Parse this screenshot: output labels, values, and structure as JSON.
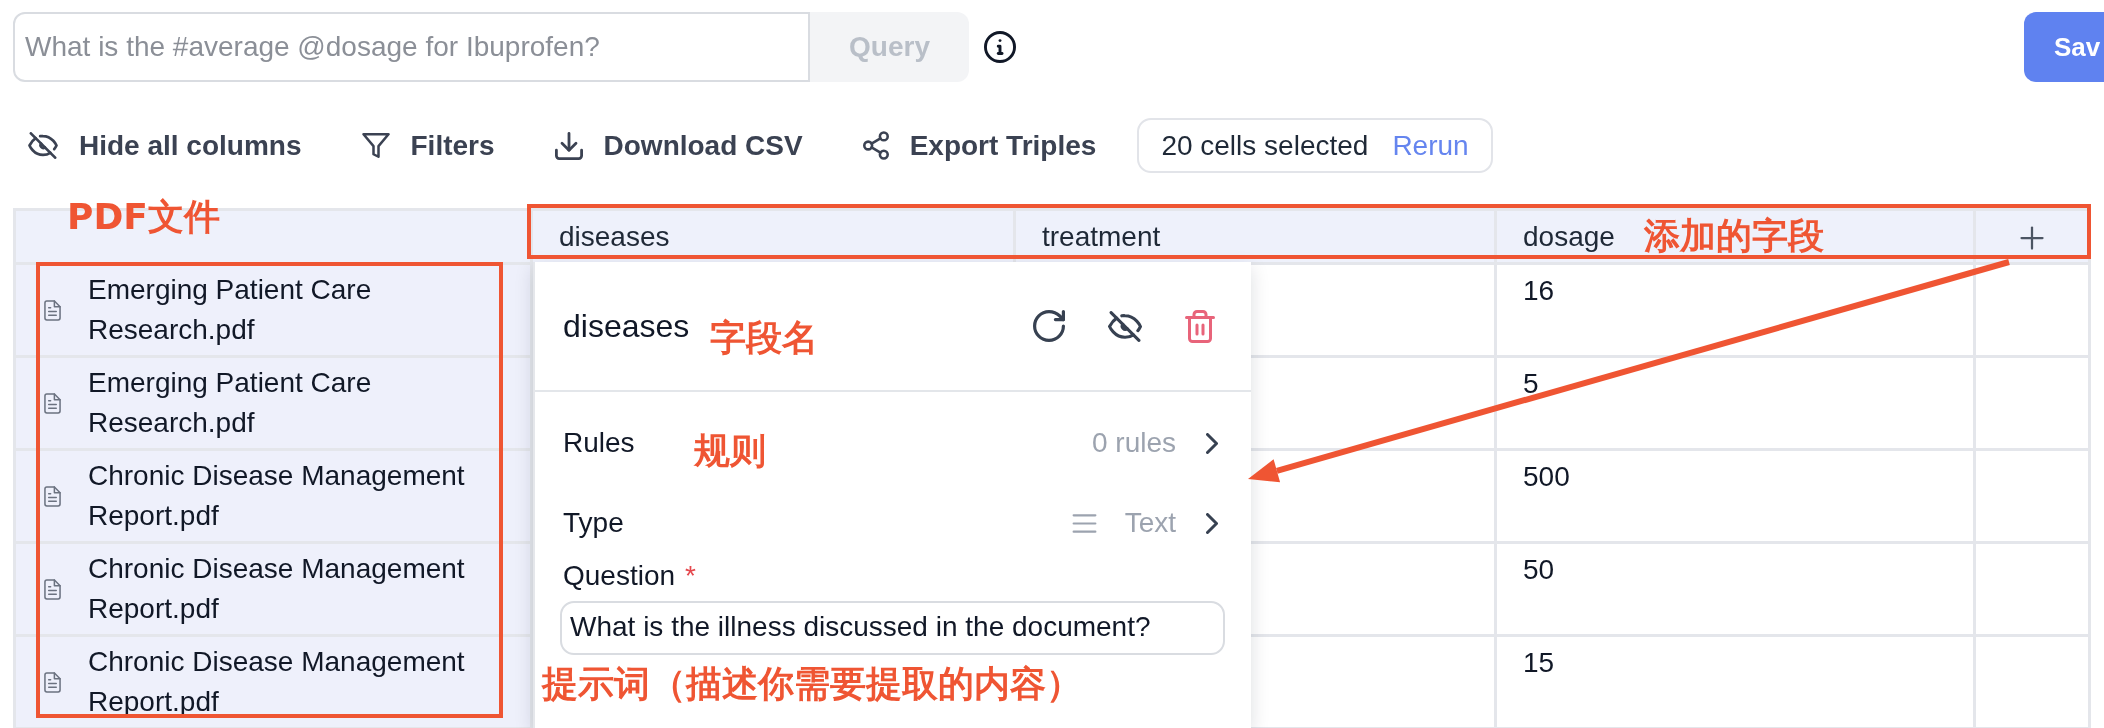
{
  "query_bar": {
    "placeholder": "What is the #average @dosage for Ibuprofen?",
    "button": {
      "label": "Query",
      "disabled": true
    }
  },
  "save_button": {
    "label": "Sav"
  },
  "toolbar": [
    "Hide all columns",
    "Filters",
    "Download CSV",
    "Export Triples"
  ],
  "selection": {
    "text": "20 cells selected",
    "action": "Rerun"
  },
  "table": {
    "columns": [
      "diseases",
      "treatment",
      "dosage"
    ],
    "rows": [
      {
        "file": "Emerging Patient Care Research.pdf",
        "dosage": "16"
      },
      {
        "file": "Emerging Patient Care Research.pdf",
        "dosage": "5"
      },
      {
        "file": "Chronic Disease Management Report.pdf",
        "dosage": "500"
      },
      {
        "file": "Chronic Disease Management Report.pdf",
        "dosage": "50"
      },
      {
        "file": "Chronic Disease Management Report.pdf",
        "dosage": "15"
      }
    ]
  },
  "column_panel": {
    "title": "diseases",
    "rules": {
      "label": "Rules",
      "value": "0 rules"
    },
    "type": {
      "label": "Type",
      "value": "Text"
    },
    "question": {
      "label": "Question",
      "required_mark": "*",
      "value": "What is the illness discussed in the document?"
    }
  },
  "annotations": [
    "PDF文件",
    "添加的字段",
    "字段名",
    "规则",
    "提示词（描述你需要提取的内容）"
  ]
}
